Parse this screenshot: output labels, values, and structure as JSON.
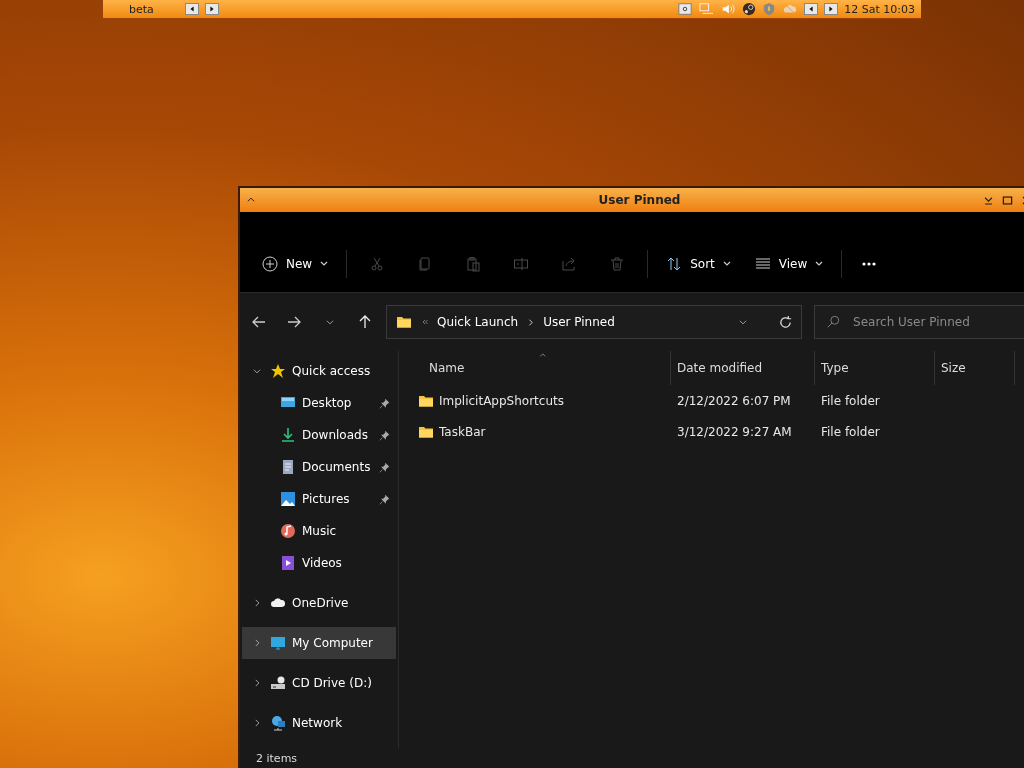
{
  "top_bar": {
    "label": "beta",
    "clock": "12 Sat 10:03"
  },
  "window": {
    "title": "User Pinned"
  },
  "toolbar": {
    "new_label": "New",
    "edit_actions": [
      {
        "disabled": true
      },
      {
        "disabled": true
      },
      {
        "disabled": true
      },
      {
        "disabled": true
      },
      {
        "disabled": true
      },
      {
        "disabled": true
      }
    ],
    "sort_label": "Sort",
    "view_label": "View"
  },
  "address": {
    "breadcrumbs": [
      "Quick Launch",
      "User Pinned"
    ],
    "search_placeholder": "Search User Pinned"
  },
  "columns": [
    {
      "label": "Name",
      "sorted": true
    },
    {
      "label": "Date modified",
      "sorted": false
    },
    {
      "label": "Type",
      "sorted": false
    },
    {
      "label": "Size",
      "sorted": false
    }
  ],
  "files": [
    {
      "name": "ImplicitAppShortcuts",
      "date": "2/12/2022 6:07 PM",
      "type": "File folder"
    },
    {
      "name": "TaskBar",
      "date": "3/12/2022 9:27 AM",
      "type": "File folder"
    }
  ],
  "nav": [
    {
      "label": "Quick access",
      "expanded": true,
      "selected": false,
      "children": [
        {
          "label": "Desktop",
          "pinned": true
        },
        {
          "label": "Downloads",
          "pinned": true
        },
        {
          "label": "Documents",
          "pinned": true
        },
        {
          "label": "Pictures",
          "pinned": true
        },
        {
          "label": "Music",
          "pinned": false
        },
        {
          "label": "Videos",
          "pinned": false
        }
      ]
    },
    {
      "label": "OneDrive",
      "expanded": false,
      "selected": false
    },
    {
      "label": "My Computer",
      "expanded": false,
      "selected": true
    },
    {
      "label": "CD Drive (D:)",
      "expanded": false,
      "selected": false
    },
    {
      "label": "Network",
      "expanded": false,
      "selected": false
    }
  ],
  "status_bar": {
    "count": "2 items"
  }
}
